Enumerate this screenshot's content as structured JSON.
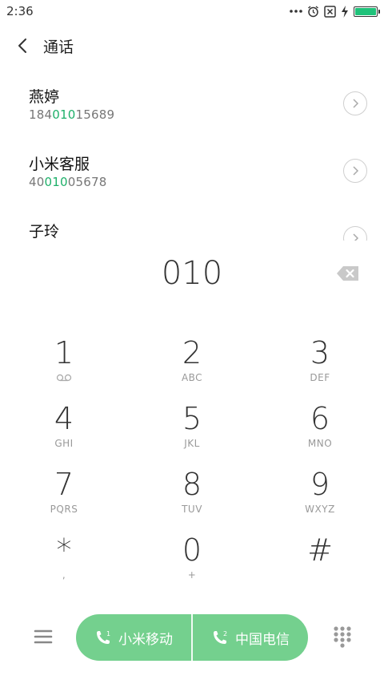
{
  "status_bar": {
    "time": "2:36",
    "icons": [
      "more-dots-icon",
      "alarm-icon",
      "no-sim-icon",
      "charging-icon",
      "battery-icon"
    ],
    "battery_level": 1.0,
    "battery_color": "#1fc27a"
  },
  "header": {
    "title": "通话",
    "back_icon": "chevron-left-icon"
  },
  "contacts": [
    {
      "name": "燕婷",
      "number_pre": "184",
      "number_match": "010",
      "number_post": "15689"
    },
    {
      "name": "小米客服",
      "number_pre": "40",
      "number_match": "010",
      "number_post": "05678"
    },
    {
      "name": "子玲",
      "number_pre": "",
      "number_match": "",
      "number_post": ""
    }
  ],
  "dial_input": {
    "value": "010"
  },
  "keypad": [
    {
      "digit": "1",
      "letters": ""
    },
    {
      "digit": "2",
      "letters": "ABC"
    },
    {
      "digit": "3",
      "letters": "DEF"
    },
    {
      "digit": "4",
      "letters": "GHI"
    },
    {
      "digit": "5",
      "letters": "JKL"
    },
    {
      "digit": "6",
      "letters": "MNO"
    },
    {
      "digit": "7",
      "letters": "PQRS"
    },
    {
      "digit": "8",
      "letters": "TUV"
    },
    {
      "digit": "9",
      "letters": "WXYZ"
    },
    {
      "digit": "*",
      "letters": ","
    },
    {
      "digit": "0",
      "letters": "+"
    },
    {
      "digit": "#",
      "letters": ""
    }
  ],
  "call_buttons": [
    {
      "label": "小米移动",
      "sim": "1"
    },
    {
      "label": "中国电信",
      "sim": "2"
    }
  ],
  "colors": {
    "accent_green": "#1fb06a",
    "call_button_bg": "#74d08e",
    "text_primary": "#111111",
    "text_secondary": "#777777"
  }
}
